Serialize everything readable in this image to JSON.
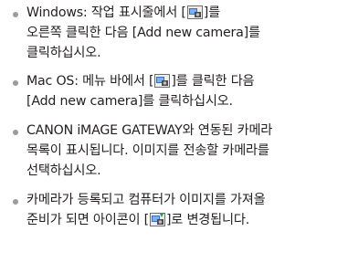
{
  "items": [
    {
      "lines": [
        {
          "before": "Windows: 작업 표시줄에서 [",
          "icon": "camera-window-icon",
          "after": "]를"
        },
        {
          "text": "오른쪽 클릭한 다음 [Add new camera]를"
        },
        {
          "text": "클릭하십시오."
        }
      ]
    },
    {
      "lines": [
        {
          "before": "Mac OS: 메뉴 바에서 [",
          "icon": "camera-window-icon",
          "after": "]를 클릭한 다음"
        },
        {
          "text": "[Add new camera]를 클릭하십시오."
        }
      ]
    },
    {
      "lines": [
        {
          "text": "CANON iMAGE GATEWAY와 연동된 카메라"
        },
        {
          "text": "목록이 표시됩니다. 이미지를 전송할 카메라를"
        },
        {
          "text": "선택하십시오."
        }
      ]
    },
    {
      "lines": [
        {
          "text": "카메라가 등록되고 컴퓨터가 이미지를 가져올"
        },
        {
          "before": "준비가 되면 아이콘이 [",
          "icon": "camera-window-ready-icon",
          "after": "]로 변경됩니다."
        }
      ]
    }
  ]
}
